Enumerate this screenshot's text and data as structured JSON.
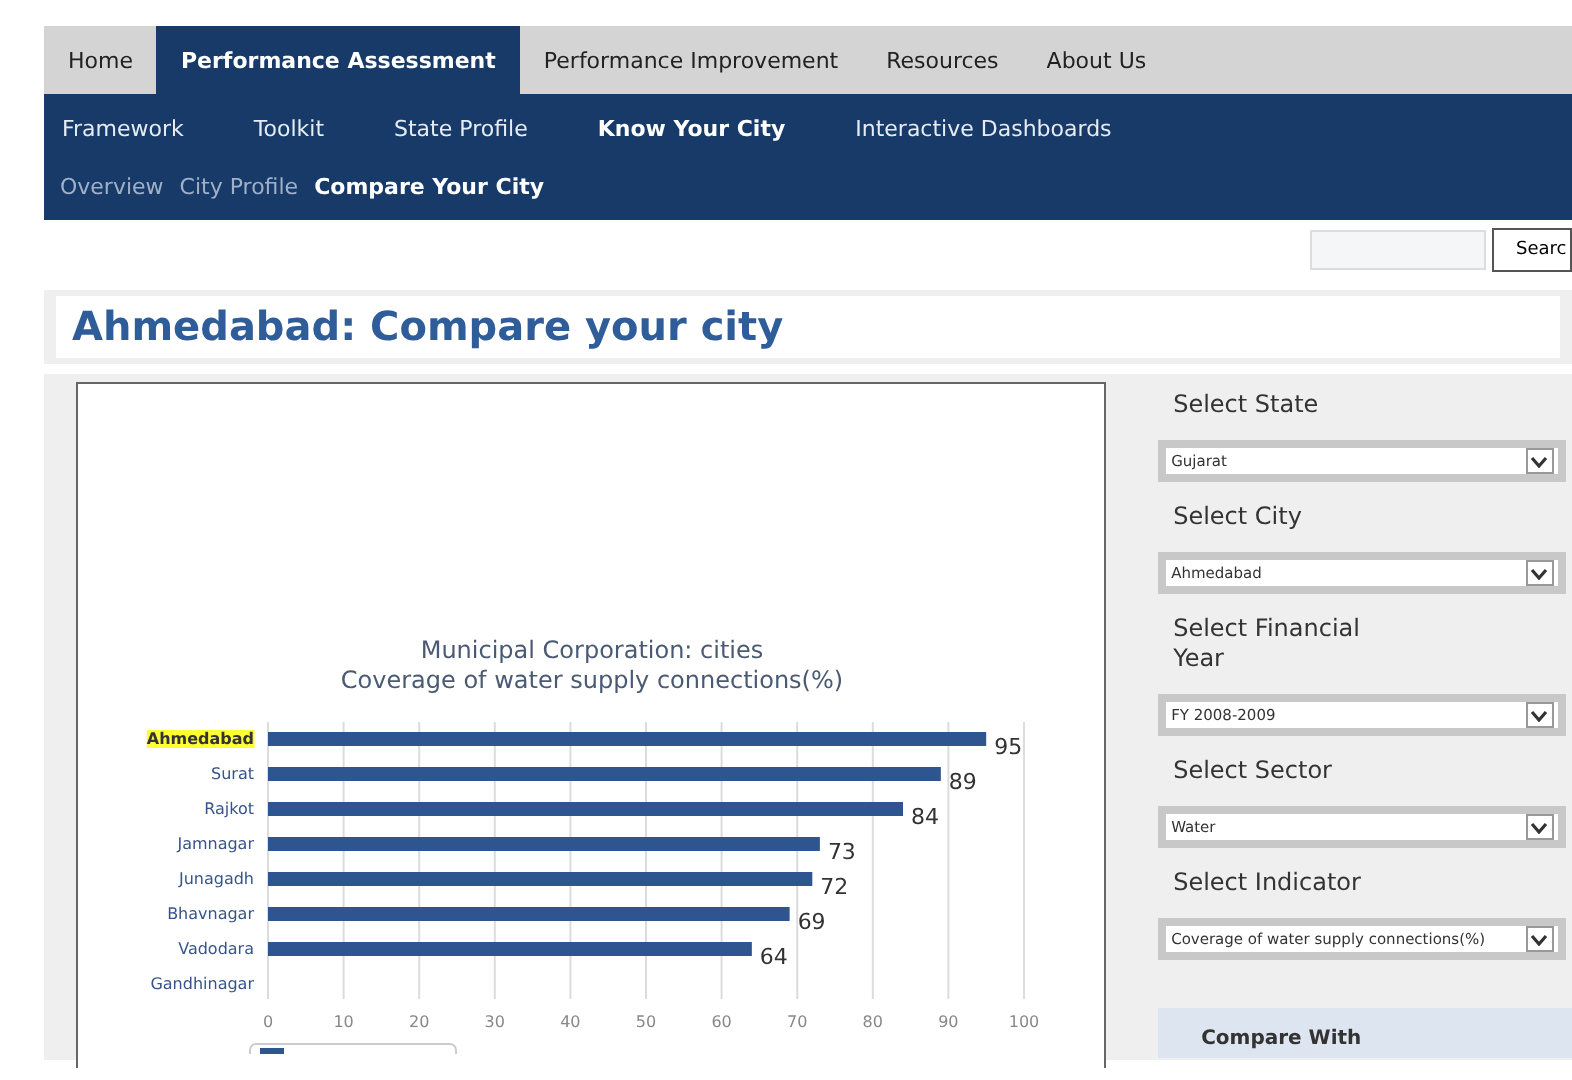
{
  "main_tabs": [
    {
      "label": "Home",
      "selected": false
    },
    {
      "label": "Performance Assessment",
      "selected": true
    },
    {
      "label": "Performance Improvement",
      "selected": false
    },
    {
      "label": "Resources",
      "selected": false
    },
    {
      "label": "About Us",
      "selected": false
    }
  ],
  "sub_nav": [
    {
      "label": "Framework",
      "selected": false
    },
    {
      "label": "Toolkit",
      "selected": false
    },
    {
      "label": "State Profile",
      "selected": false
    },
    {
      "label": "Know Your City",
      "selected": true
    },
    {
      "label": "Interactive Dashboards",
      "selected": false
    }
  ],
  "third_nav": [
    {
      "label": "Overview",
      "selected": false
    },
    {
      "label": "City Profile",
      "selected": false
    },
    {
      "label": "Compare Your City",
      "selected": true
    }
  ],
  "search": {
    "button": "Searc"
  },
  "page_title": "Ahmedabad: Compare your city",
  "chart": {
    "category_highlighted": [
      true,
      false,
      false,
      false,
      false,
      false,
      false,
      false
    ],
    "chart_data": {
      "type": "bar",
      "orientation": "horizontal",
      "title": "Municipal Corporation: cities\nCoverage of water supply connections(%)",
      "categories": [
        "Ahmedabad",
        "Surat",
        "Rajkot",
        "Jamnagar",
        "Junagadh",
        "Bhavnagar",
        "Vadodara",
        "Gandhinagar"
      ],
      "series": [
        {
          "color": "#2f5590",
          "values": [
            95,
            89,
            84,
            73,
            72,
            69,
            64,
            null
          ]
        }
      ],
      "xlim": [
        0,
        100
      ],
      "xticks": [
        0,
        10,
        20,
        30,
        40,
        50,
        60,
        70,
        80,
        90,
        100
      ],
      "grid": true,
      "data_labels": true
    }
  },
  "filters": [
    {
      "label": "Select State",
      "value": "Gujarat"
    },
    {
      "label": "Select City",
      "value": "Ahmedabad"
    },
    {
      "label": "Select Financial Year",
      "value": "FY 2008-2009"
    },
    {
      "label": "Select Sector",
      "value": "Water"
    },
    {
      "label": "Select Indicator",
      "value": "Coverage of water supply connections(%)"
    }
  ],
  "compare_heading": "Compare With"
}
